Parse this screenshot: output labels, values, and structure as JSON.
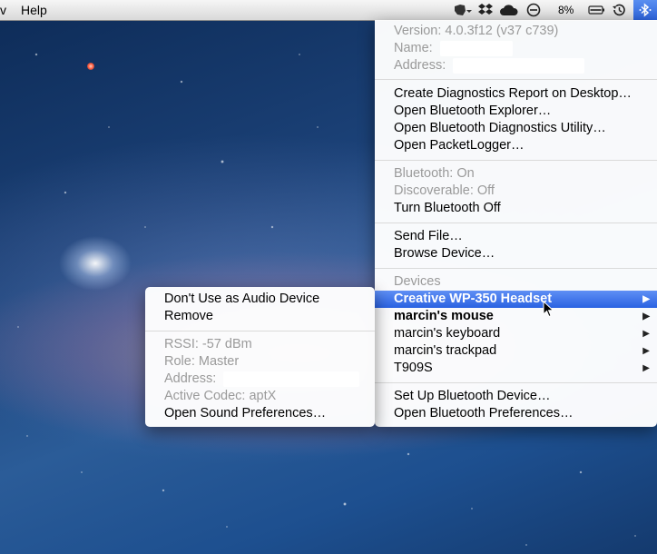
{
  "menubar": {
    "app_menu_partial": "v",
    "help_label": "Help",
    "battery": "8%",
    "status_icons": [
      "evernote-icon",
      "dropbox-icon",
      "cloud-icon",
      "do-not-disturb-icon",
      "battery-icon",
      "time-machine-icon",
      "bluetooth-icon"
    ]
  },
  "bluetooth_menu": {
    "info": {
      "version": "Version: 4.0.3f12 (v37 c739)",
      "name_label": "Name:",
      "address_label": "Address:"
    },
    "tools": [
      "Create Diagnostics Report on Desktop…",
      "Open Bluetooth Explorer…",
      "Open Bluetooth Diagnostics Utility…",
      "Open PacketLogger…"
    ],
    "status": {
      "bluetooth_on": "Bluetooth: On",
      "discoverable": "Discoverable: Off",
      "turn_off": "Turn Bluetooth Off"
    },
    "file_actions": [
      "Send File…",
      "Browse Device…"
    ],
    "devices_header": "Devices",
    "devices": [
      {
        "label": "Creative WP-350 Headset",
        "highlighted": true,
        "bold": true
      },
      {
        "label": "marcin's mouse",
        "bold": true
      },
      {
        "label": "marcin's keyboard"
      },
      {
        "label": "marcin's trackpad"
      },
      {
        "label": "T909S"
      }
    ],
    "setup": [
      "Set Up Bluetooth Device…",
      "Open Bluetooth Preferences…"
    ]
  },
  "device_submenu": {
    "actions": [
      "Don't Use as Audio Device",
      "Remove"
    ],
    "info": {
      "rssi": "RSSI: -57 dBm",
      "role": "Role: Master",
      "address_label": "Address:",
      "codec": "Active Codec: aptX"
    },
    "open_sound_prefs": "Open Sound Preferences…"
  },
  "colors": {
    "highlight": "#2a62e2",
    "disabled_text": "#9a9a9a"
  }
}
